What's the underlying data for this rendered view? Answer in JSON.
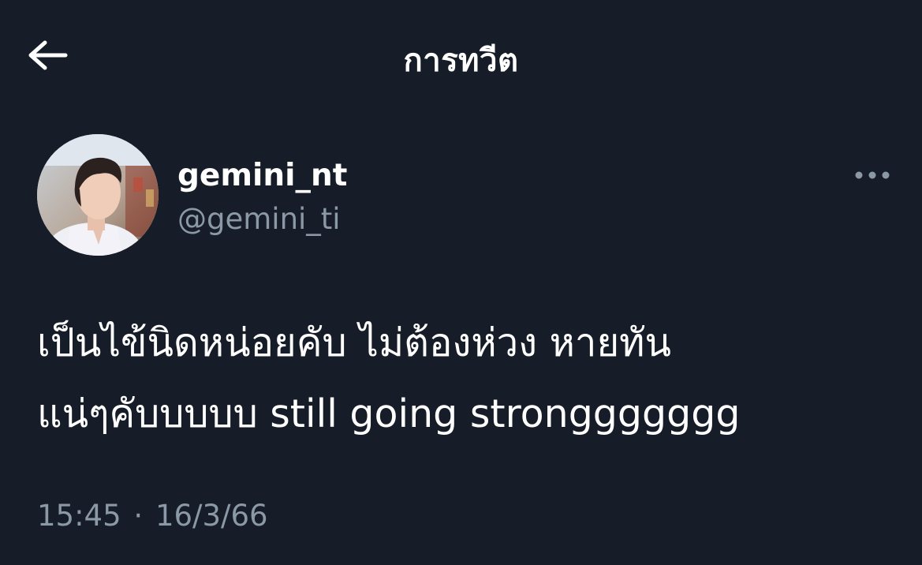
{
  "header": {
    "title": "การทวีต",
    "back_icon": "back-arrow-icon"
  },
  "author": {
    "display_name": "gemini_nt",
    "handle": "@gemini_ti",
    "avatar_icon": "avatar",
    "more_icon": "more-horizontal-icon"
  },
  "tweet": {
    "text_line_1": "เป็นไข้นิดหน่อยคับ ไม่ต้องห่วง หายทัน",
    "text_line_2": "แน่ๆคับบบบบ still going stronggggggg"
  },
  "meta": {
    "time": "15:45",
    "separator": "·",
    "date": "16/3/66"
  },
  "colors": {
    "background": "#161d29",
    "primary_text": "#ffffff",
    "secondary_text": "#8b98a5"
  }
}
